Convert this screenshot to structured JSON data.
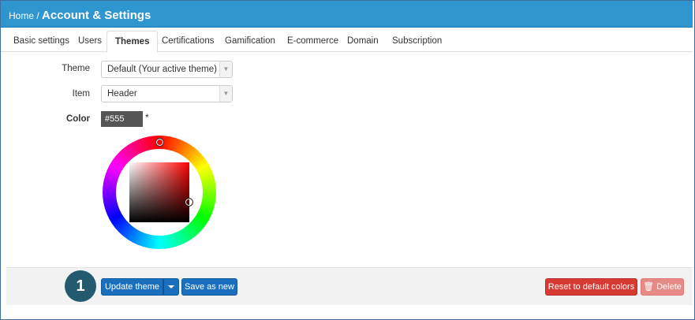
{
  "header": {
    "breadcrumb_home": "Home /",
    "title": "Account & Settings"
  },
  "tabs": [
    {
      "label": "Basic settings",
      "active": false
    },
    {
      "label": "Users",
      "active": false
    },
    {
      "label": "Themes",
      "active": true
    },
    {
      "label": "Certifications",
      "active": false
    },
    {
      "label": "Gamification",
      "active": false
    },
    {
      "label": "E-commerce",
      "active": false
    },
    {
      "label": "Domain",
      "active": false
    },
    {
      "label": "Subscription",
      "active": false
    }
  ],
  "form": {
    "theme_label": "Theme",
    "theme_value": "Default (Your active theme)",
    "item_label": "Item",
    "item_value": "Header",
    "color_label": "Color",
    "color_value": "#555",
    "required_mark": "*"
  },
  "footer": {
    "step_number": "1",
    "update_label": "Update theme",
    "save_as_new_label": "Save as new",
    "reset_label": "Reset to default colors",
    "delete_label": "Delete"
  },
  "colors": {
    "header_bg": "#2f95ce",
    "primary_button": "#1a6fbf",
    "danger_button": "#d63a32",
    "step_badge": "#235a6e",
    "selected_color": "#555555"
  },
  "icons": {
    "dropdown_caret": "chevron-down-icon",
    "delete": "trash-icon"
  }
}
